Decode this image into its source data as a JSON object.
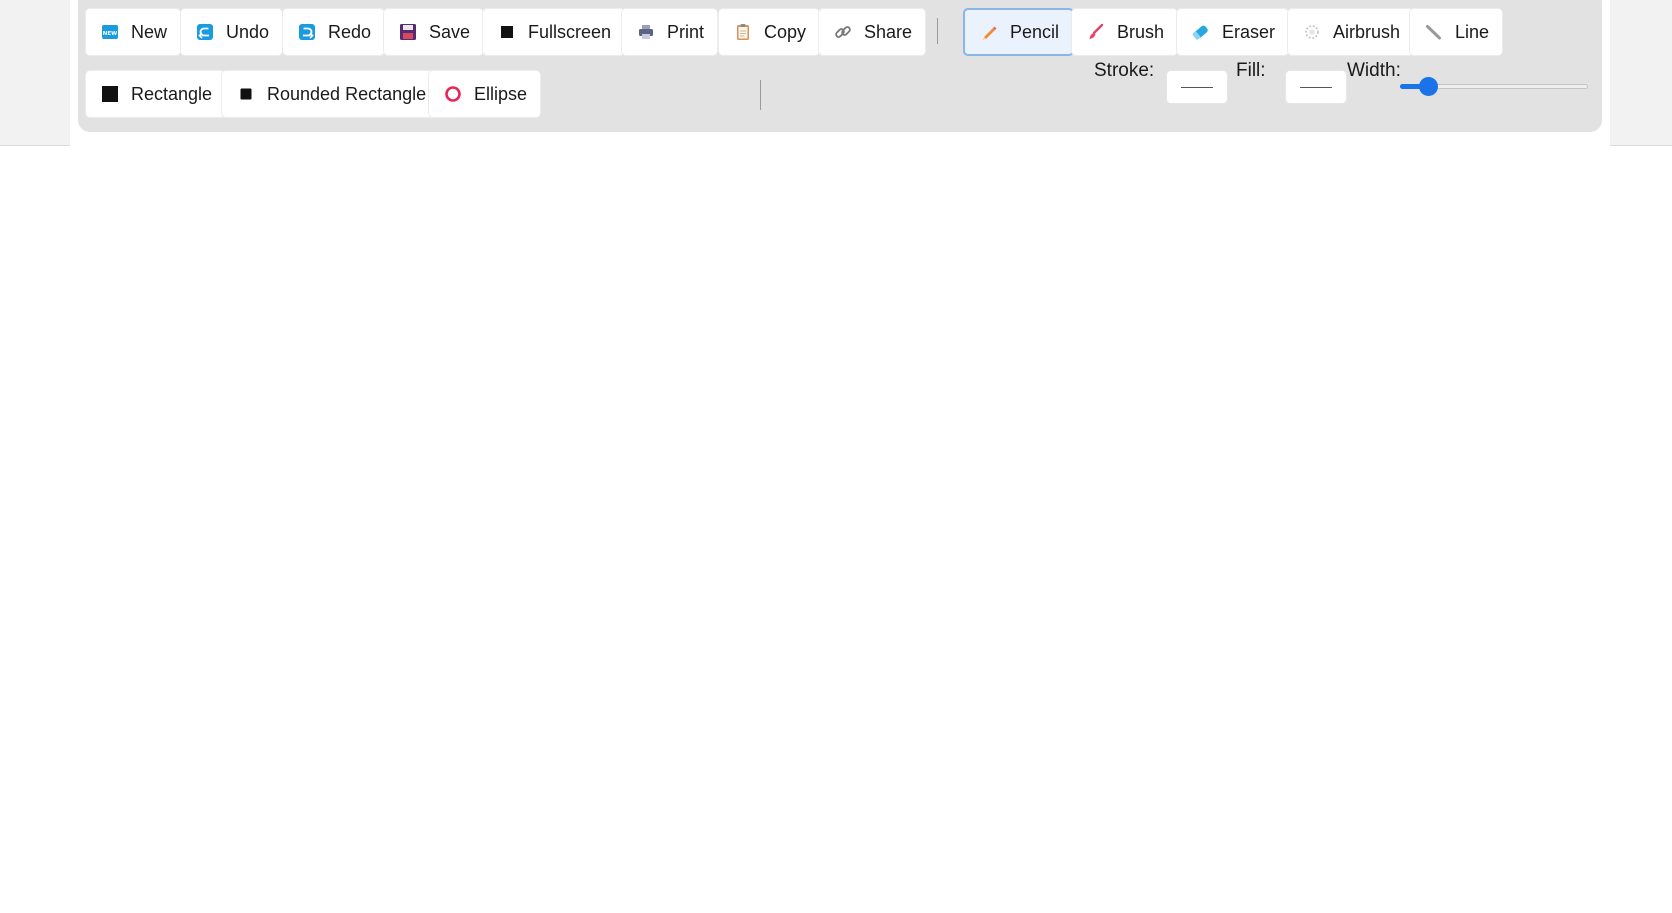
{
  "toolbar": {
    "row1": [
      {
        "label": "New",
        "icon": "new-icon"
      },
      {
        "label": "Undo",
        "icon": "undo-icon"
      },
      {
        "label": "Redo",
        "icon": "redo-icon"
      },
      {
        "label": "Save",
        "icon": "floppy-disk-icon"
      },
      {
        "label": "Fullscreen",
        "icon": "black-square-icon"
      },
      {
        "label": "Print",
        "icon": "printer-icon"
      },
      {
        "label": "Copy",
        "icon": "clipboard-icon"
      },
      {
        "label": "Share",
        "icon": "link-icon"
      }
    ],
    "tools": [
      {
        "label": "Pencil",
        "icon": "pencil-icon",
        "active": true
      },
      {
        "label": "Brush",
        "icon": "brush-icon"
      },
      {
        "label": "Eraser",
        "icon": "eraser-icon"
      },
      {
        "label": "Airbrush",
        "icon": "airbrush-icon"
      },
      {
        "label": "Line",
        "icon": "line-icon"
      }
    ],
    "shapes": [
      {
        "label": "Rectangle",
        "icon": "black-large-square-icon"
      },
      {
        "label": "Rounded Rectangle",
        "icon": "black-small-square-icon"
      },
      {
        "label": "Ellipse",
        "icon": "hollow-circle-icon"
      }
    ],
    "stroke_label": "Stroke:",
    "fill_label": "Fill:",
    "width_label": "Width:",
    "width_level": 0.15,
    "accent_color": "#1a73e8"
  }
}
